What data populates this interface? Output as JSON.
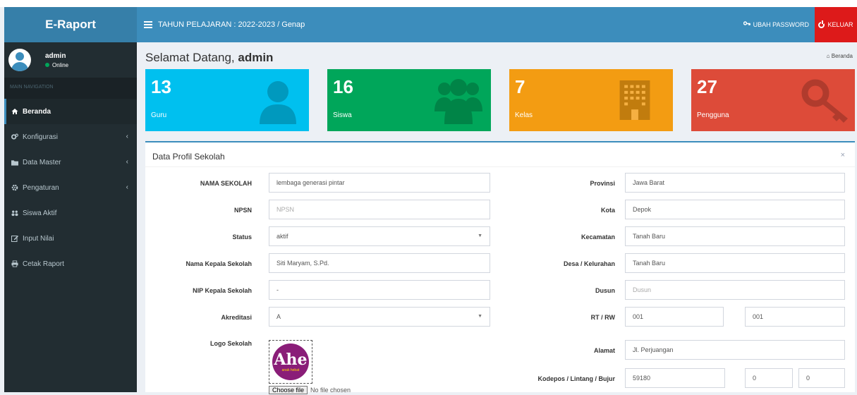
{
  "app": {
    "title": "E-Raport"
  },
  "user": {
    "name": "admin",
    "status": "Online"
  },
  "sidebar": {
    "header": "MAIN NAVIGATION",
    "items": [
      {
        "label": "Beranda",
        "icon": "home-icon",
        "active": true
      },
      {
        "label": "Konfigurasi",
        "icon": "cogs-icon",
        "caret": "‹"
      },
      {
        "label": "Data Master",
        "icon": "folder-icon",
        "caret": "‹"
      },
      {
        "label": "Pengaturan",
        "icon": "gear-icon",
        "caret": "‹"
      },
      {
        "label": "Siswa Aktif",
        "icon": "users-icon"
      },
      {
        "label": "Input Nilai",
        "icon": "edit-icon"
      },
      {
        "label": "Cetak Raport",
        "icon": "print-icon"
      }
    ]
  },
  "header": {
    "academic_year": "TAHUN PELAJARAN : 2022-2023 / Genap",
    "change_password": "UBAH PASSWORD",
    "logout": "KELUAR"
  },
  "page": {
    "welcome_prefix": "Selamat Datang,",
    "welcome_user": "admin",
    "breadcrumb": "Beranda"
  },
  "stats": [
    {
      "value": "13",
      "label": "Guru",
      "color": "#00c0ef",
      "icon": "user-icon"
    },
    {
      "value": "16",
      "label": "Siswa",
      "color": "#00a65a",
      "icon": "users-icon"
    },
    {
      "value": "7",
      "label": "Kelas",
      "color": "#f39c12",
      "icon": "building-icon"
    },
    {
      "value": "27",
      "label": "Pengguna",
      "color": "#dd4b39",
      "icon": "key-icon"
    }
  ],
  "profile": {
    "title": "Data Profil Sekolah",
    "close": "×",
    "left": {
      "nama_sekolah": {
        "label": "NAMA SEKOLAH",
        "value": "lembaga generasi pintar"
      },
      "npsn": {
        "label": "NPSN",
        "placeholder": "NPSN"
      },
      "status": {
        "label": "Status",
        "value": "aktif"
      },
      "kepala": {
        "label": "Nama Kepala Sekolah",
        "value": "Siti Maryam, S.Pd."
      },
      "nip": {
        "label": "NIP Kepala Sekolah",
        "value": "-"
      },
      "akreditasi": {
        "label": "Akreditasi",
        "value": "A"
      },
      "logo": {
        "label": "Logo Sekolah",
        "logo_text": "Ahe",
        "logo_subtext": "anak hebat",
        "file_button": "Choose file",
        "file_status": "No file chosen"
      }
    },
    "right": {
      "provinsi": {
        "label": "Provinsi",
        "value": "Jawa Barat"
      },
      "kota": {
        "label": "Kota",
        "value": "Depok"
      },
      "kecamatan": {
        "label": "Kecamatan",
        "value": "Tanah Baru"
      },
      "desa": {
        "label": "Desa / Kelurahan",
        "value": "Tanah Baru"
      },
      "dusun": {
        "label": "Dusun",
        "placeholder": "Dusun"
      },
      "rtrw": {
        "label": "RT / RW",
        "rt": "001",
        "rw": "001"
      },
      "alamat": {
        "label": "Alamat",
        "value": "Jl. Perjuangan"
      },
      "kodepos": {
        "label": "Kodepos / Lintang / Bujur",
        "kodepos": "59180",
        "lintang": "0",
        "bujur": "0"
      }
    }
  }
}
